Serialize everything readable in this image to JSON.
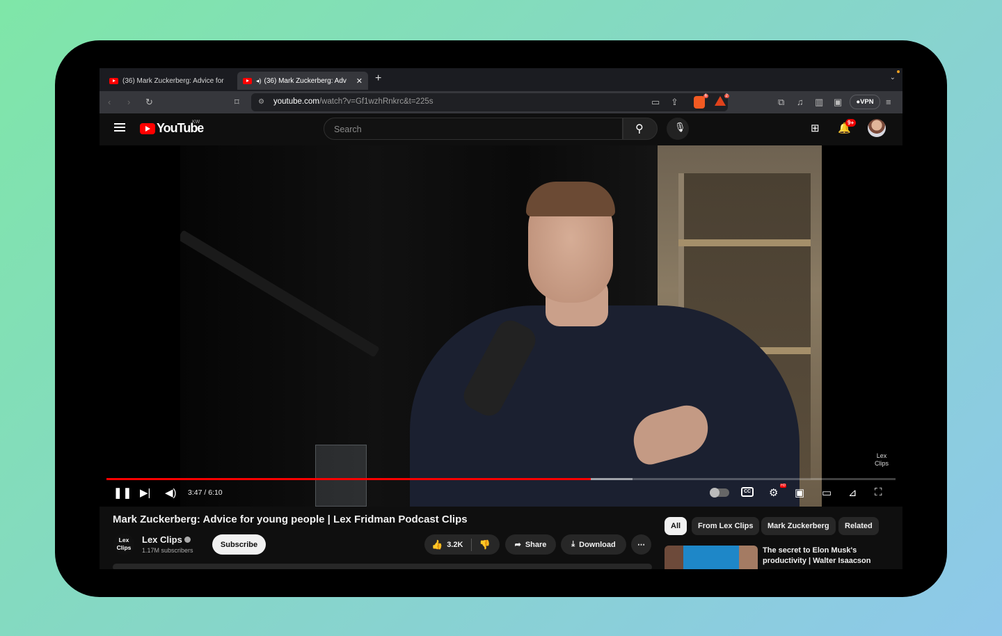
{
  "browser": {
    "tabs": [
      {
        "title": "(36) Mark Zuckerberg: Advice for",
        "active": false
      },
      {
        "title": "(36) Mark Zuckerberg: Adv",
        "active": true,
        "audio": true
      }
    ],
    "new_tab_label": "+",
    "url": {
      "host": "youtube.com",
      "path": "/watch?v=Gf1wzhRnkrc&t=225s"
    },
    "vpn_label": "VPN",
    "shield_badge": "6",
    "rewards_badge": "2"
  },
  "youtube": {
    "logo_text": "YouTube",
    "country_code": "KW",
    "search_placeholder": "Search",
    "notification_count": "9+"
  },
  "player": {
    "time_current": "3:47",
    "time_total": "6:10",
    "time_label": "3:47 / 6:10",
    "progress_played_fraction": 0.614,
    "progress_buffered_fraction": 0.667,
    "watermark": "Lex\nClips",
    "cc_label": "CC",
    "hd_label": "HD"
  },
  "video": {
    "title": "Mark Zuckerberg: Advice for young people | Lex Fridman Podcast Clips",
    "channel_name": "Lex Clips",
    "channel_avatar_text": "Lex Clips",
    "subscribers": "1.17M subscribers",
    "subscribe_label": "Subscribe",
    "likes": "3.2K",
    "share_label": "Share",
    "download_label": "Download",
    "more_label": "⋯"
  },
  "related": {
    "chips": [
      "All",
      "From Lex Clips",
      "Mark Zuckerberg",
      "Related"
    ],
    "first_title": "The secret to Elon Musk's productivity | Walter Isaacson"
  },
  "colors": {
    "accent": "#ff0000",
    "background": "#0f0f0f"
  }
}
